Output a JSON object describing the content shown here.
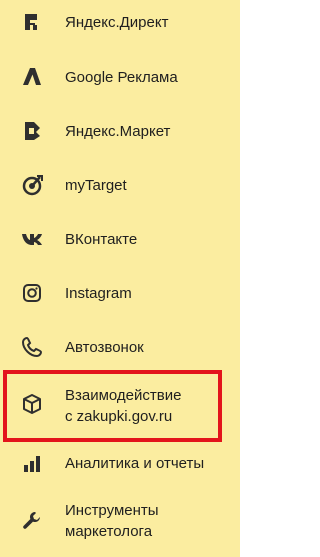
{
  "menu": {
    "items": [
      {
        "label": "Яндекс.Директ",
        "icon": "yandex-direct-icon"
      },
      {
        "label": "Google Реклама",
        "icon": "google-ads-icon"
      },
      {
        "label": "Яндекс.Маркет",
        "icon": "yandex-market-icon"
      },
      {
        "label": "myTarget",
        "icon": "mytarget-icon"
      },
      {
        "label": "ВКонтакте",
        "icon": "vk-icon"
      },
      {
        "label": "Instagram",
        "icon": "instagram-icon"
      },
      {
        "label": "Автозвонок",
        "icon": "phone-icon"
      },
      {
        "label_line1": "Взаимодействие",
        "label_line2": "с zakupki.gov.ru",
        "icon": "box-icon",
        "highlighted": true
      },
      {
        "label": "Аналитика и отчеты",
        "icon": "bar-chart-icon"
      },
      {
        "label_line1": "Инструменты",
        "label_line2": "маркетолога",
        "icon": "wrench-icon"
      }
    ]
  },
  "colors": {
    "panel_background": "#fbeda0",
    "text": "#1f1f1f",
    "icon": "#2f2f2f",
    "highlight_border": "#e3141b"
  }
}
